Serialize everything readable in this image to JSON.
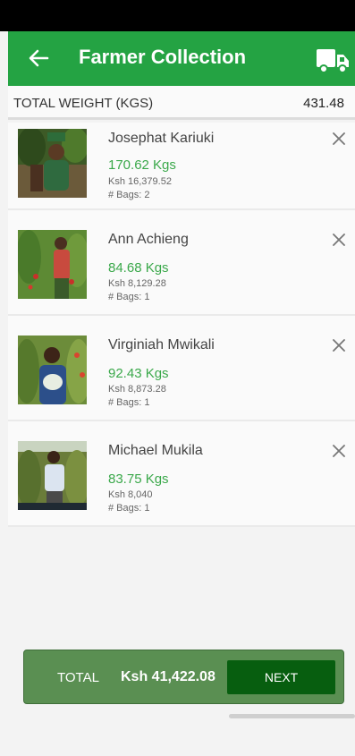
{
  "header": {
    "title": "Farmer Collection"
  },
  "summary": {
    "weight_label": "TOTAL WEIGHT (KGS)",
    "weight_value": "431.48"
  },
  "farmers": [
    {
      "name": "Josephat Kariuki",
      "kgs": "170.62 Kgs",
      "ksh": "Ksh 16,379.52",
      "bags": "# Bags: 2"
    },
    {
      "name": "Ann Achieng",
      "kgs": "84.68 Kgs",
      "ksh": "Ksh 8,129.28",
      "bags": "# Bags: 1"
    },
    {
      "name": "Virginiah Mwikali",
      "kgs": "92.43 Kgs",
      "ksh": "Ksh 8,873.28",
      "bags": "# Bags: 1"
    },
    {
      "name": "Michael Mukila",
      "kgs": "83.75 Kgs",
      "ksh": "Ksh 8,040",
      "bags": "# Bags: 1"
    }
  ],
  "footer": {
    "total_label": "TOTAL",
    "total_value": "Ksh 41,422.08",
    "next_label": "NEXT"
  },
  "icons": {
    "back": "arrow-left-icon",
    "truck": "truck-icon",
    "remove": "close-icon"
  },
  "colors": {
    "primary": "#24a343",
    "weight_text": "#3aa84a",
    "footer_bg": "#5a8f52",
    "next_bg": "#075e0f"
  }
}
